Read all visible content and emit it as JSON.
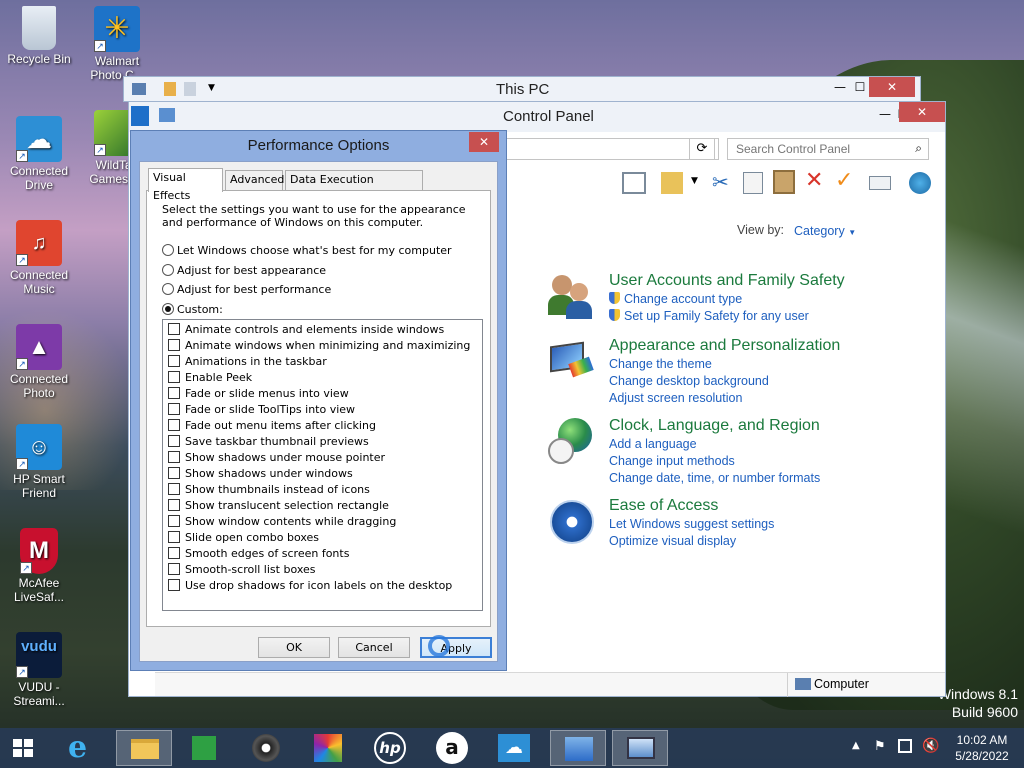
{
  "desktop": {
    "icons": [
      {
        "label": "Recycle Bin"
      },
      {
        "label": "Walmart Photo C..."
      },
      {
        "label": "Connected Drive"
      },
      {
        "label": "WildTan Games f..."
      },
      {
        "label": "Connected Music"
      },
      {
        "label": "Connected Photo"
      },
      {
        "label": "HP Smart Friend"
      },
      {
        "label": "McAfee LiveSaf..."
      },
      {
        "label": "VUDU - Streami..."
      }
    ],
    "watermark_line1": "Windows 8.1",
    "watermark_line2": "Build 9600"
  },
  "this_pc": {
    "title": "This PC"
  },
  "control_panel": {
    "title": "Control Panel",
    "search_placeholder": "Search Control Panel",
    "view_by_label": "View by:",
    "view_by_value": "Category",
    "status_text": "Computer",
    "categories": [
      {
        "title": "User Accounts and Family Safety",
        "links": [
          "Change account type",
          "Set up Family Safety for any user"
        ]
      },
      {
        "title": "Appearance and Personalization",
        "links": [
          "Change the theme",
          "Change desktop background",
          "Adjust screen resolution"
        ]
      },
      {
        "title": "Clock, Language, and Region",
        "links": [
          "Add a language",
          "Change input methods",
          "Change date, time, or number formats"
        ]
      },
      {
        "title": "Ease of Access",
        "links": [
          "Let Windows suggest settings",
          "Optimize visual display"
        ]
      }
    ]
  },
  "perf_dialog": {
    "title": "Performance Options",
    "tabs": [
      "Visual Effects",
      "Advanced",
      "Data Execution Prevention"
    ],
    "description": "Select the settings you want to use for the appearance and performance of Windows on this computer.",
    "radios": [
      {
        "label": "Let Windows choose what's best for my computer",
        "selected": false
      },
      {
        "label": "Adjust for best appearance",
        "selected": false
      },
      {
        "label": "Adjust for best performance",
        "selected": false
      },
      {
        "label": "Custom:",
        "selected": true
      }
    ],
    "options": [
      "Animate controls and elements inside windows",
      "Animate windows when minimizing and maximizing",
      "Animations in the taskbar",
      "Enable Peek",
      "Fade or slide menus into view",
      "Fade or slide ToolTips into view",
      "Fade out menu items after clicking",
      "Save taskbar thumbnail previews",
      "Show shadows under mouse pointer",
      "Show shadows under windows",
      "Show thumbnails instead of icons",
      "Show translucent selection rectangle",
      "Show window contents while dragging",
      "Slide open combo boxes",
      "Smooth edges of screen fonts",
      "Smooth-scroll list boxes",
      "Use drop shadows for icon labels on the desktop"
    ],
    "ok_label": "OK",
    "cancel_label": "Cancel",
    "apply_label": "Apply"
  },
  "taskbar": {
    "time": "10:02 AM",
    "date": "5/28/2022"
  }
}
